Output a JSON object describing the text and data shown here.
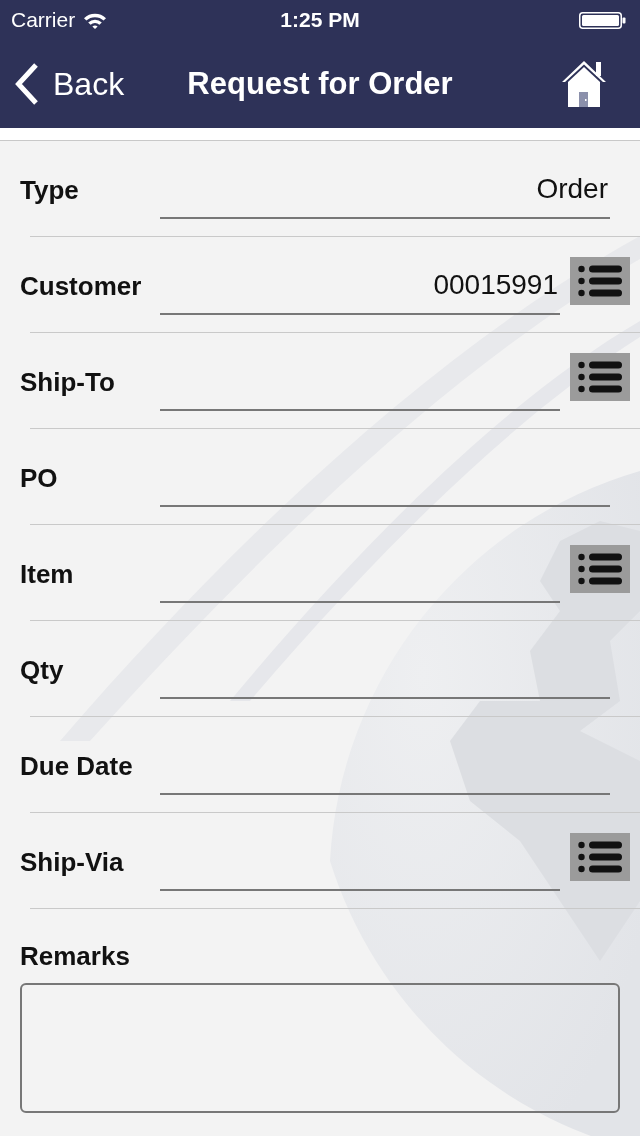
{
  "status_bar": {
    "carrier": "Carrier",
    "time": "1:25 PM"
  },
  "nav_bar": {
    "back": "Back",
    "title": "Request for Order"
  },
  "fields": [
    {
      "label": "Type",
      "value": "Order",
      "kind": "text"
    },
    {
      "label": "Customer",
      "value": "00015991",
      "kind": "lookup"
    },
    {
      "label": "Ship-To",
      "kind": "lookup"
    },
    {
      "label": "PO",
      "kind": "text"
    },
    {
      "label": "Item",
      "kind": "lookup"
    },
    {
      "label": "Qty",
      "kind": "text"
    },
    {
      "label": "Due Date",
      "kind": "text"
    },
    {
      "label": "Ship-Via",
      "kind": "lookup"
    }
  ],
  "remarks": {
    "label": "Remarks"
  }
}
